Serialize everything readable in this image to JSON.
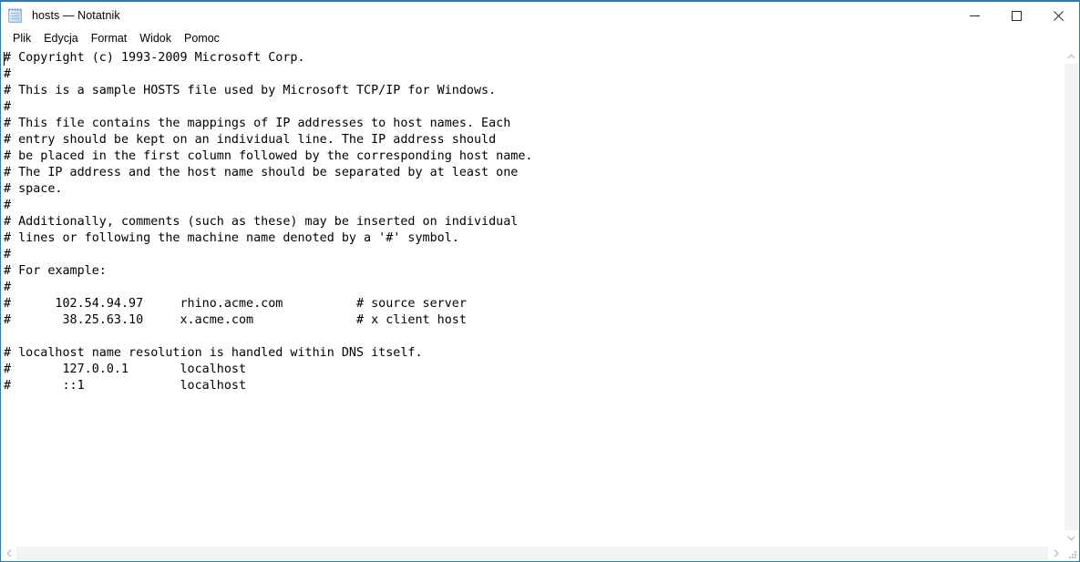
{
  "window": {
    "title": "hosts — Notatnik",
    "icon": "notepad-icon",
    "accent_color": "#2a7ab0",
    "border_color": "#2f7cb0",
    "background": "#ffffff",
    "text_color": "#000000"
  },
  "titlebar": {
    "minimize_label": "—",
    "maximize_label": "□",
    "close_label": "✕"
  },
  "menu": {
    "items": [
      {
        "label": "Plik"
      },
      {
        "label": "Edycja"
      },
      {
        "label": "Format"
      },
      {
        "label": "Widok"
      },
      {
        "label": "Pomoc"
      }
    ]
  },
  "editor": {
    "content": "# Copyright (c) 1993-2009 Microsoft Corp.\n#\n# This is a sample HOSTS file used by Microsoft TCP/IP for Windows.\n#\n# This file contains the mappings of IP addresses to host names. Each\n# entry should be kept on an individual line. The IP address should\n# be placed in the first column followed by the corresponding host name.\n# The IP address and the host name should be separated by at least one\n# space.\n#\n# Additionally, comments (such as these) may be inserted on individual\n# lines or following the machine name denoted by a '#' symbol.\n#\n# For example:\n#\n#      102.54.94.97     rhino.acme.com          # source server\n#       38.25.63.10     x.acme.com              # x client host\n\n# localhost name resolution is handled within DNS itself.\n#       127.0.0.1       localhost\n#       ::1             localhost\n",
    "lines": [
      "# Copyright (c) 1993-2009 Microsoft Corp.",
      "#",
      "# This is a sample HOSTS file used by Microsoft TCP/IP for Windows.",
      "#",
      "# This file contains the mappings of IP addresses to host names. Each",
      "# entry should be kept on an individual line. The IP address should",
      "# be placed in the first column followed by the corresponding host name.",
      "# The IP address and the host name should be separated by at least one",
      "# space.",
      "#",
      "# Additionally, comments (such as these) may be inserted on individual",
      "# lines or following the machine name denoted by a '#' symbol.",
      "#",
      "# For example:",
      "#",
      "#      102.54.94.97     rhino.acme.com          # source server",
      "#       38.25.63.10     x.acme.com              # x client host",
      "",
      "# localhost name resolution is handled within DNS itself.",
      "#       127.0.0.1       localhost",
      "#       ::1             localhost"
    ],
    "host_entries": [
      {
        "ip": "102.54.94.97",
        "host": "rhino.acme.com",
        "comment": "# source server"
      },
      {
        "ip": "38.25.63.10",
        "host": "x.acme.com",
        "comment": "# x client host"
      },
      {
        "ip": "127.0.0.1",
        "host": "localhost",
        "comment": ""
      },
      {
        "ip": "::1",
        "host": "localhost",
        "comment": ""
      }
    ]
  },
  "scrollbars": {
    "vertical": {
      "up_arrow": "⌃",
      "down_arrow": "⌄"
    },
    "horizontal": {
      "left_arrow": "‹",
      "right_arrow": "›"
    }
  }
}
